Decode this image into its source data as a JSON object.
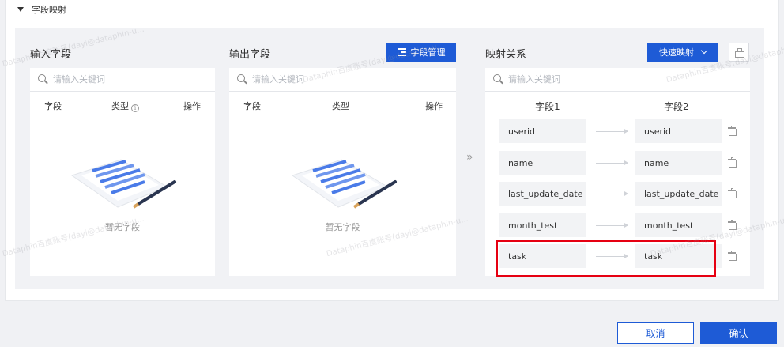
{
  "section": {
    "title": "字段映射"
  },
  "input_panel": {
    "title": "输入字段",
    "search_placeholder": "请输入关键词",
    "columns": [
      "字段",
      "类型",
      "操作"
    ],
    "info_glyph": "i",
    "empty_text": "暂无字段"
  },
  "output_panel": {
    "title": "输出字段",
    "manage_button": "字段管理",
    "search_placeholder": "请输入关键词",
    "columns": [
      "字段",
      "类型",
      "操作"
    ],
    "empty_text": "暂无字段"
  },
  "mapping_panel": {
    "title": "映射关系",
    "quick_map_button": "快速映射",
    "search_placeholder": "请输入关键词",
    "col1": "字段1",
    "col2": "字段2",
    "rows": [
      {
        "field1": "userid",
        "field2": "userid"
      },
      {
        "field1": "name",
        "field2": "name"
      },
      {
        "field1": "last_update_date",
        "field2": "last_update_date"
      },
      {
        "field1": "month_test",
        "field2": "month_test"
      },
      {
        "field1": "task",
        "field2": "task"
      }
    ],
    "highlighted_row": 4
  },
  "watermark_text": "Dataphin百度账号(dayi@dataphin-u...",
  "footer": {
    "cancel": "取消",
    "confirm": "确认"
  },
  "colors": {
    "primary": "#1e5bd6",
    "highlight": "#e60012"
  }
}
